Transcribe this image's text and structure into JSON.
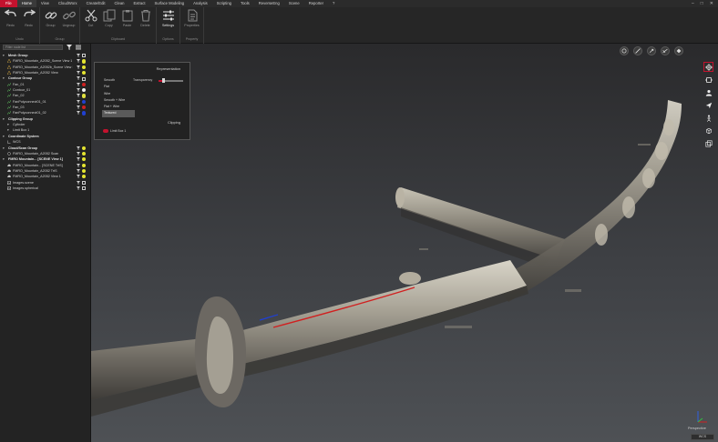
{
  "menu": {
    "items": [
      "File",
      "Home",
      "View",
      "CloudWorx",
      "Create/Edit",
      "Clean",
      "Extract",
      "Surface Modeling",
      "Analysis",
      "Scripting",
      "Tools",
      "ReverseEng",
      "Scene",
      "Reporter",
      "?"
    ],
    "active_index": 1
  },
  "ribbon": {
    "groups": [
      {
        "label": "Undo",
        "buttons": [
          {
            "label": "Redo",
            "icon": "undo-icon"
          },
          {
            "label": "Redo",
            "icon": "redo-icon"
          }
        ]
      },
      {
        "label": "Group",
        "buttons": [
          {
            "label": "Group",
            "icon": "link-icon"
          },
          {
            "label": "Ungroup",
            "icon": "unlink-icon"
          }
        ]
      },
      {
        "label": "Clipboard",
        "buttons": [
          {
            "label": "Cut",
            "icon": "scissors-icon"
          },
          {
            "label": "Copy",
            "icon": "copy-icon"
          },
          {
            "label": "Paste",
            "icon": "paste-icon"
          },
          {
            "label": "Delete",
            "icon": "trash-icon"
          }
        ]
      },
      {
        "label": "Options",
        "buttons": [
          {
            "label": "Settings",
            "icon": "sliders-icon",
            "on": true
          }
        ]
      },
      {
        "label": "Property",
        "buttons": [
          {
            "label": "Properties",
            "icon": "document-icon"
          }
        ]
      }
    ]
  },
  "panel": {
    "search_placeholder": "Filter node list",
    "tree": [
      {
        "label": "Mesh Group",
        "level": 0,
        "group": true,
        "icon": "arrow",
        "status": "square"
      },
      {
        "label": "FMRO_Mountain_A2052_Scene View 1",
        "level": 1,
        "icon": "mesh-icon",
        "status": "dot",
        "color": "#e4e430"
      },
      {
        "label": "FMRO_Mountain_A2052b_Scene View 1",
        "level": 1,
        "icon": "mesh-icon",
        "status": "dot",
        "color": "#e4e430"
      },
      {
        "label": "FMRO_Mountain_A2052 View",
        "level": 1,
        "icon": "mesh-icon",
        "status": "dot",
        "color": "#e4e430"
      },
      {
        "label": "Contour Group",
        "level": 0,
        "group": true,
        "icon": "arrow",
        "status": "square"
      },
      {
        "label": "Fan_01",
        "level": 1,
        "icon": "line-icon",
        "status": "dot",
        "color": "#d02020"
      },
      {
        "label": "Contour_01",
        "level": 1,
        "icon": "line-icon",
        "status": "dot",
        "color": "#f0f0f0"
      },
      {
        "label": "Fan_02",
        "level": 1,
        "icon": "line-icon",
        "status": "dot",
        "color": "#e0e040"
      },
      {
        "label": "FanPolyconnect01_01",
        "level": 1,
        "icon": "line-icon",
        "status": "dot",
        "color": "#2040d0"
      },
      {
        "label": "Fan_03",
        "level": 1,
        "icon": "line-icon",
        "status": "dot",
        "color": "#d02020"
      },
      {
        "label": "FanPolyconnect01_02",
        "level": 1,
        "icon": "line-icon",
        "status": "dot",
        "color": "#2040d0"
      },
      {
        "label": "Clipping Group",
        "level": 0,
        "group": true,
        "icon": "arrow",
        "status": "none"
      },
      {
        "label": "Cylinder",
        "level": 1,
        "icon": "arrow",
        "status": "none"
      },
      {
        "label": "Limit Box 1",
        "level": 1,
        "icon": "arrow",
        "status": "none"
      },
      {
        "label": "Coordinate System",
        "level": 0,
        "group": true,
        "icon": "arrow",
        "status": "none"
      },
      {
        "label": "WCS",
        "level": 1,
        "icon": "axis-icon",
        "status": "none"
      },
      {
        "label": "Cloud/Scan Group",
        "level": 0,
        "group": true,
        "icon": "arrow",
        "status": "dot",
        "color": "#e4e430"
      },
      {
        "label": "FMRO_Mountain_A2052 Scan",
        "level": 1,
        "icon": "scan-icon",
        "status": "dot",
        "color": "#e4e430"
      },
      {
        "label": "FMRO Mountain... [SCENE View 1]",
        "level": 0,
        "group": true,
        "icon": "arrow",
        "status": "dot",
        "color": "#e4e430"
      },
      {
        "label": "FMRO_Mountain... [SCENE TrtS]",
        "level": 1,
        "icon": "cloud-icon",
        "status": "dot",
        "color": "#e4e430"
      },
      {
        "label": "FMRO_Mountain_A2052 TrtS",
        "level": 1,
        "icon": "cloud-icon",
        "status": "dot",
        "color": "#e4e430"
      },
      {
        "label": "FMRO_Mountain_A2052 View 1",
        "level": 1,
        "icon": "cloud-icon",
        "status": "dot",
        "color": "#e4e430"
      },
      {
        "label": "Images.scene",
        "level": 1,
        "icon": "image-icon",
        "status": "square"
      },
      {
        "label": "Images.spherical",
        "level": 1,
        "icon": "image-icon",
        "status": "square"
      }
    ]
  },
  "representation": {
    "title": "Representation",
    "transparency_label": "Transparency",
    "transparency_value": 0.2,
    "options": [
      "Smooth",
      "Flat",
      "Wire",
      "Smooth + Wire",
      "Flat + Wire",
      "Textured"
    ],
    "selected_index": 5,
    "clipping_title": "Clipping",
    "clipping_item": "Limit Box 1"
  },
  "viewport": {
    "axis_label": "Perspective",
    "status": "WCS"
  },
  "colors": {
    "accent": "#c4122e",
    "contour_red": "#d02020",
    "contour_blue": "#2040d0"
  }
}
